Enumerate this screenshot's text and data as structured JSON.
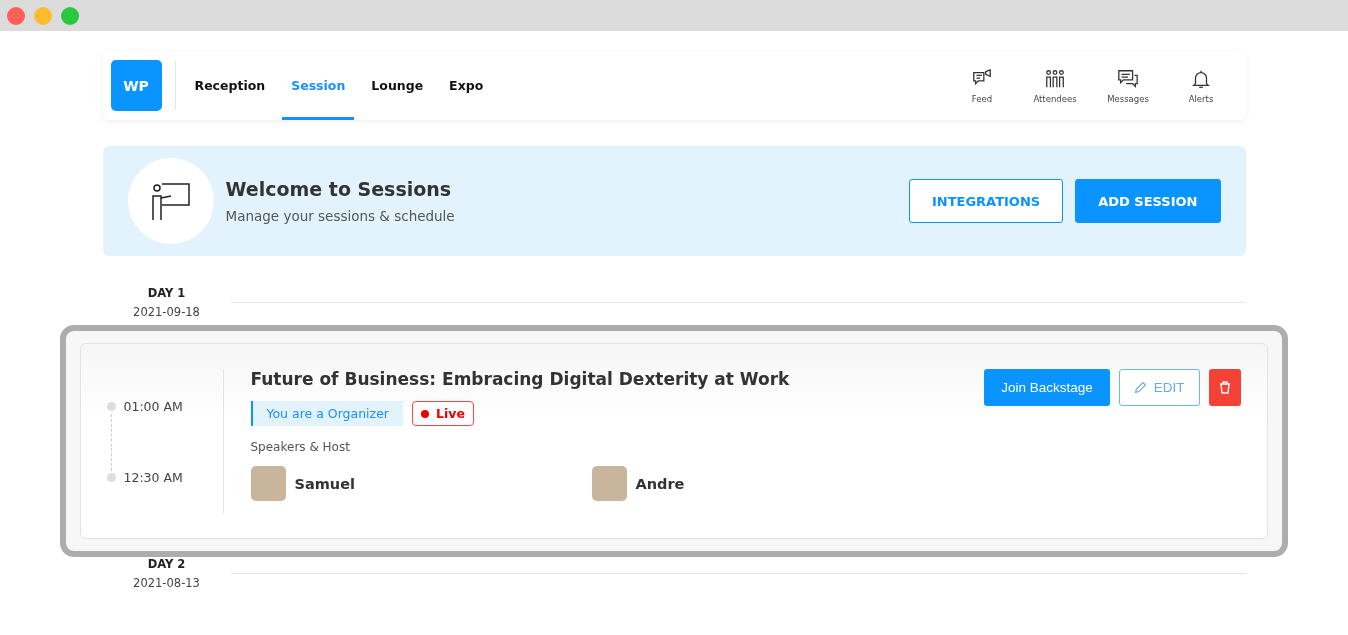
{
  "logo": "WP",
  "nav": [
    {
      "label": "Reception",
      "selected": false
    },
    {
      "label": "Session",
      "selected": true
    },
    {
      "label": "Lounge",
      "selected": false
    },
    {
      "label": "Expo",
      "selected": false
    }
  ],
  "actions": [
    {
      "kind": "feed",
      "label": "Feed"
    },
    {
      "kind": "attendees",
      "label": "Attendees"
    },
    {
      "kind": "messages",
      "label": "Messages"
    },
    {
      "kind": "alerts",
      "label": "Alerts"
    }
  ],
  "banner": {
    "title": "Welcome to Sessions",
    "subtitle": "Manage your sessions & schedule",
    "buttons": [
      {
        "kind": "outline",
        "label": "INTEGRATIONS"
      },
      {
        "kind": "solid",
        "label": "ADD SESSION"
      }
    ]
  },
  "days": [
    {
      "day": "DAY 1",
      "date": "2021-09-18",
      "sessions": [
        {
          "start": "01:00 AM",
          "end": "12:30 AM",
          "title": "Future of Business: Embracing Digital Dexterity at Work",
          "role": "You are a Organizer",
          "live": true,
          "live_label": "Live",
          "speakers_label": "Speakers & Host",
          "speakers": [
            "Samuel",
            "Andre"
          ],
          "join": "Join Backstage",
          "edit": "EDIT"
        }
      ]
    },
    {
      "day": "DAY 2",
      "date": "2021-08-13"
    }
  ]
}
